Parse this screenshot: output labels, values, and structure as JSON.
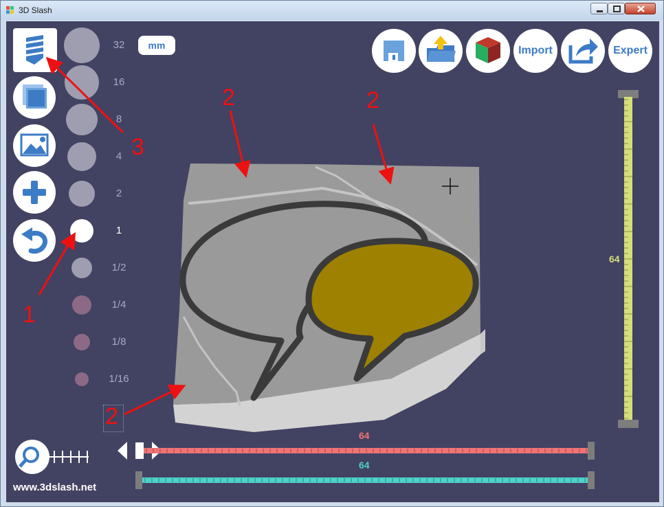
{
  "window": {
    "title": "3D Slash"
  },
  "tools": {
    "shaver_icon": "shaver-icon",
    "cube_icon": "cube-icon",
    "image_icon": "image-icon",
    "add_icon": "plus-icon",
    "undo_icon": "undo-icon"
  },
  "sizes": [
    "32",
    "16",
    "8",
    "4",
    "2",
    "1",
    "1/2",
    "1/4",
    "1/8",
    "1/16"
  ],
  "selected_size": "1",
  "unit": "mm",
  "top_buttons": {
    "save_icon": "save-icon",
    "open_icon": "open-folder-icon",
    "color_icon": "color-cube-icon",
    "import_label": "Import",
    "share_icon": "share-icon",
    "expert_label": "Expert"
  },
  "sliders": {
    "vertical_value": "64",
    "red_value": "64",
    "cyan_value": "64"
  },
  "colors": {
    "bg": "#424262",
    "red": "#f07476",
    "cyan": "#4fd0c8",
    "yellow": "#d5de78",
    "accent": "#3c7bc6"
  },
  "annotations": {
    "labels": [
      "1",
      "2",
      "2",
      "2",
      "3"
    ]
  },
  "footer": {
    "website": "www.3dslash.net"
  }
}
